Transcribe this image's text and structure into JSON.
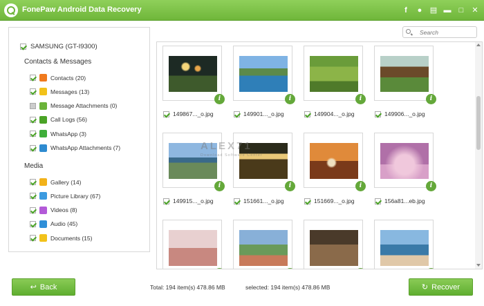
{
  "app": {
    "title": "FonePaw Android Data Recovery"
  },
  "titlebar_icons": [
    "facebook-icon",
    "chat-icon",
    "feedback-icon",
    "minimize-icon",
    "maximize-icon",
    "close-icon"
  ],
  "sidebar": {
    "device": "SAMSUNG (GT-I9300)",
    "sections": [
      {
        "label": "Contacts & Messages",
        "items": [
          {
            "label": "Contacts (20)",
            "icon": "contacts-icon",
            "color": "#f07a1e",
            "checked": true
          },
          {
            "label": "Messages (13)",
            "icon": "messages-icon",
            "color": "#f2c21a",
            "checked": true
          },
          {
            "label": "Message Attachments (0)",
            "icon": "attachment-icon",
            "color": "#6bb33a",
            "checked": false
          },
          {
            "label": "Call Logs (56)",
            "icon": "call-logs-icon",
            "color": "#4aa326",
            "checked": true
          },
          {
            "label": "WhatsApp (3)",
            "icon": "whatsapp-icon",
            "color": "#3fae3a",
            "checked": true
          },
          {
            "label": "WhatsApp Attachments (7)",
            "icon": "whatsapp-attachments-icon",
            "color": "#2e8bd0",
            "checked": true
          }
        ]
      },
      {
        "label": "Media",
        "items": [
          {
            "label": "Gallery (14)",
            "icon": "gallery-icon",
            "color": "#f2b21a",
            "checked": true
          },
          {
            "label": "Picture Library (67)",
            "icon": "picture-library-icon",
            "color": "#3c9be0",
            "checked": true
          },
          {
            "label": "Videos (8)",
            "icon": "videos-icon",
            "color": "#b35ad8",
            "checked": true
          },
          {
            "label": "Audio (45)",
            "icon": "audio-icon",
            "color": "#2f8fd8",
            "checked": true
          },
          {
            "label": "Documents (15)",
            "icon": "documents-icon",
            "color": "#f2c21a",
            "checked": true
          }
        ]
      }
    ]
  },
  "search": {
    "placeholder": "Search"
  },
  "photos": [
    {
      "name": "149867..._o.jpg",
      "checked": true
    },
    {
      "name": "149901..._o.jpg",
      "checked": true
    },
    {
      "name": "149904..._o.jpg",
      "checked": true
    },
    {
      "name": "149906..._o.jpg",
      "checked": true
    },
    {
      "name": "149915..._o.jpg",
      "checked": true
    },
    {
      "name": "151661..._o.jpg",
      "checked": true
    },
    {
      "name": "151669..._o.jpg",
      "checked": true
    },
    {
      "name": "156a81...eb.jpg",
      "checked": true
    },
    {
      "name": "",
      "checked": false
    },
    {
      "name": "",
      "checked": false
    },
    {
      "name": "",
      "checked": false
    },
    {
      "name": "",
      "checked": false
    }
  ],
  "watermark": {
    "main": "ALEX71",
    "sub": "Download Software Center"
  },
  "footer": {
    "back_label": "Back",
    "recover_label": "Recover",
    "total": "Total: 194 item(s) 478.86 MB",
    "selected": "selected: 194 item(s) 478.86 MB"
  }
}
